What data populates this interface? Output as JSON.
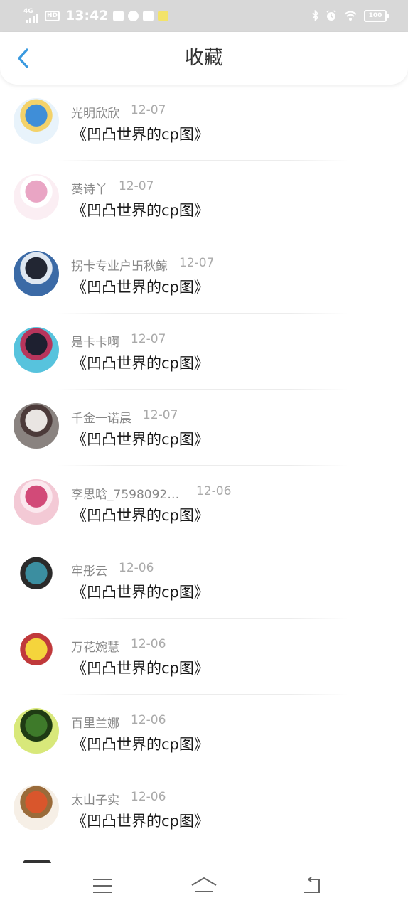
{
  "status_bar": {
    "network": "4G",
    "hd": "HD",
    "time": "13:42",
    "battery": "100",
    "left_icons": [
      "check-icon",
      "app-icon",
      "search-app-icon",
      "emoji-app-icon"
    ],
    "right_icons": [
      "bluetooth-icon",
      "alarm-icon",
      "wifi-icon",
      "battery-icon"
    ]
  },
  "header": {
    "title": "收藏",
    "back_icon": "chevron-left-icon",
    "accent": "#3a9ae0"
  },
  "favorites": [
    {
      "user": "光明欣欣",
      "date": "12-07",
      "title": "《凹凸世界的cp图》",
      "avatar_colors": [
        "#e8f3fb",
        "#3f8ed8",
        "#f3d26a"
      ]
    },
    {
      "user": "葵诗丫",
      "date": "12-07",
      "title": "《凹凸世界的cp图》",
      "avatar_colors": [
        "#fbeef3",
        "#e9a5c4",
        "#ffffff"
      ]
    },
    {
      "user": "拐卡专业户卐秋鲸",
      "date": "12-07",
      "title": "《凹凸世界的cp图》",
      "avatar_colors": [
        "#3b6aa6",
        "#222633",
        "#dfe7f1"
      ]
    },
    {
      "user": "是卡卡啊",
      "date": "12-07",
      "title": "《凹凸世界的cp图》",
      "avatar_colors": [
        "#57c3dd",
        "#1e2030",
        "#b8355c"
      ]
    },
    {
      "user": "千金一诺晨",
      "date": "12-07",
      "title": "《凹凸世界的cp图》",
      "avatar_colors": [
        "#8a8380",
        "#e9e5e2",
        "#4c3b3a"
      ]
    },
    {
      "user": "李思晗_7598092…",
      "date": "12-06",
      "title": "《凹凸世界的cp图》",
      "avatar_colors": [
        "#f3c9d5",
        "#d24a78",
        "#fbe8ee"
      ]
    },
    {
      "user": "牢彤云",
      "date": "12-06",
      "title": "《凹凸世界的cp图》",
      "avatar_colors": [
        "#ffffff",
        "#3b8ea0",
        "#2a2a2a"
      ]
    },
    {
      "user": "万花婉慧",
      "date": "12-06",
      "title": "《凹凸世界的cp图》",
      "avatar_colors": [
        "#ffffff",
        "#f5d43c",
        "#c0393b"
      ]
    },
    {
      "user": "百里兰娜",
      "date": "12-06",
      "title": "《凹凸世界的cp图》",
      "avatar_colors": [
        "#d8e87a",
        "#3e7a2a",
        "#1f3b14"
      ]
    },
    {
      "user": "太山子实",
      "date": "12-06",
      "title": "《凹凸世界的cp图》",
      "avatar_colors": [
        "#f6efe6",
        "#d9562c",
        "#9a6b3a"
      ]
    }
  ],
  "bottom_nav": {
    "items": [
      "menu-icon",
      "home-icon",
      "back-icon"
    ],
    "icon_color": "#666666"
  }
}
